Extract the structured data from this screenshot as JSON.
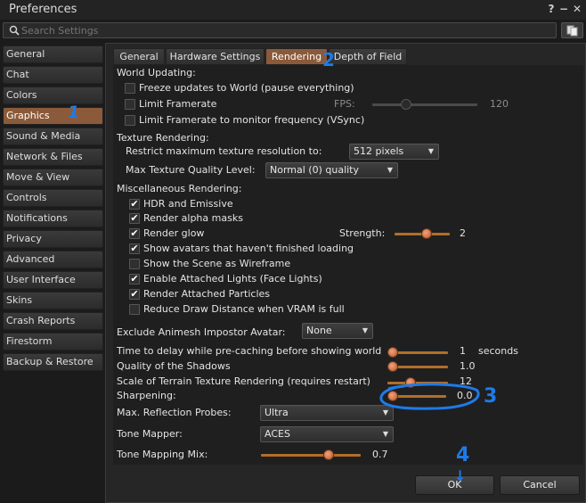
{
  "window": {
    "title": "Preferences",
    "help_glyph": "?",
    "minimize_glyph": "−",
    "close_glyph": "✕"
  },
  "search": {
    "placeholder": "Search Settings"
  },
  "sidebar": {
    "items": [
      {
        "label": "General"
      },
      {
        "label": "Chat"
      },
      {
        "label": "Colors"
      },
      {
        "label": "Graphics"
      },
      {
        "label": "Sound & Media"
      },
      {
        "label": "Network & Files"
      },
      {
        "label": "Move & View"
      },
      {
        "label": "Controls"
      },
      {
        "label": "Notifications"
      },
      {
        "label": "Privacy"
      },
      {
        "label": "Advanced"
      },
      {
        "label": "User Interface"
      },
      {
        "label": "Skins"
      },
      {
        "label": "Crash Reports"
      },
      {
        "label": "Firestorm"
      },
      {
        "label": "Backup & Restore"
      }
    ],
    "active": "Graphics"
  },
  "tabs": [
    {
      "label": "General"
    },
    {
      "label": "Hardware Settings"
    },
    {
      "label": "Rendering"
    },
    {
      "label": "Depth of Field"
    }
  ],
  "world_updating": {
    "heading": "World Updating:",
    "freeze": "Freeze updates to World (pause everything)",
    "limit_framerate": "Limit Framerate",
    "fps_label": "FPS:",
    "fps_value": "120",
    "fps_fraction": 0.3,
    "vsync": "Limit Framerate to monitor frequency (VSync)"
  },
  "texture_rendering": {
    "heading": "Texture Rendering:",
    "restrict_label": "Restrict maximum texture resolution to:",
    "restrict_value": "512 pixels",
    "max_quality_label": "Max Texture Quality Level:",
    "max_quality_value": "Normal (0) quality"
  },
  "misc": {
    "heading": "Miscellaneous Rendering:",
    "hdr": "HDR and Emissive",
    "alpha_masks": "Render alpha masks",
    "glow": "Render glow",
    "strength_label": "Strength:",
    "strength_value": "2",
    "strength_fraction": 0.6,
    "unfinished_avatars": "Show avatars that haven't finished loading",
    "wireframe": "Show the Scene as Wireframe",
    "attached_lights": "Enable Attached Lights (Face Lights)",
    "attached_particles": "Render Attached Particles",
    "reduce_draw": "Reduce Draw Distance when VRAM is full",
    "checked": {
      "hdr": true,
      "alpha_masks": true,
      "glow": true,
      "unfinished_avatars": true,
      "wireframe": false,
      "attached_lights": true,
      "attached_particles": true,
      "reduce_draw": false
    },
    "check_glyph": "✔"
  },
  "settings": {
    "animesh_label": "Exclude Animesh Impostor Avatar:",
    "animesh_value": "None",
    "precache_label": "Time to delay while pre-caching before showing world",
    "precache_value": "1",
    "precache_unit": "seconds",
    "precache_fraction": 0.0,
    "shadows_label": "Quality of the Shadows",
    "shadows_value": "1.0",
    "shadows_fraction": 0.0,
    "terrain_label": "Scale of Terrain Texture Rendering (requires restart)",
    "terrain_value": "12",
    "terrain_fraction": 0.35,
    "sharpening_label": "Sharpening:",
    "sharpening_value": "0.0",
    "sharpening_fraction": 0.0,
    "reflection_label": "Max. Reflection Probes:",
    "reflection_value": "Ultra",
    "tonemapper_label": "Tone Mapper:",
    "tonemapper_value": "ACES",
    "tonemix_label": "Tone Mapping Mix:",
    "tonemix_value": "0.7",
    "tonemix_fraction": 0.7
  },
  "buttons": {
    "ok": "OK",
    "cancel": "Cancel"
  },
  "annotations": {
    "one": "1",
    "two": "2",
    "three": "3",
    "four": "4",
    "four_arrow": "↓"
  },
  "colors": {
    "accent": "#8a5a3a",
    "slider": "#b26e28",
    "annotation": "#1f7ae8"
  }
}
